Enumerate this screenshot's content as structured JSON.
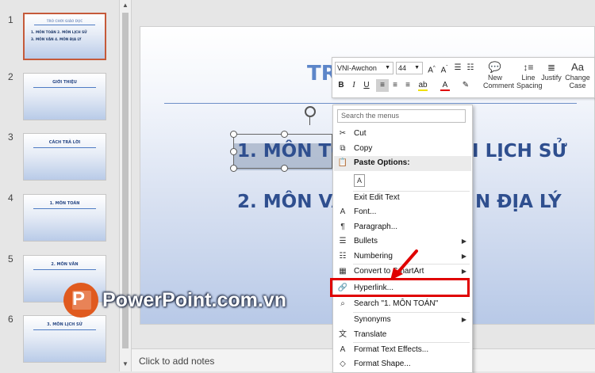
{
  "thumbnails": [
    {
      "num": "1",
      "title": "TRÒ CHƠI GIÁO DỤC",
      "lines": [
        "1. MÔN TOÁN   2. MÔN LỊCH SỬ",
        "3. MÔN VĂN    4. MÔN ĐỊA LÝ"
      ],
      "selected": true
    },
    {
      "num": "2",
      "title": "GIỚI THIỆU",
      "lines": [],
      "selected": false
    },
    {
      "num": "3",
      "title": "CÁCH TRẢ LỜI",
      "lines": [],
      "selected": false
    },
    {
      "num": "4",
      "title": "1. MÔN TOÁN",
      "lines": [],
      "selected": false
    },
    {
      "num": "5",
      "title": "2. MÔN VĂN",
      "lines": [],
      "selected": false
    },
    {
      "num": "6",
      "title": "3. MÔN LỊCH SỬ",
      "lines": [],
      "selected": false
    }
  ],
  "slide": {
    "title_fragment": "TR",
    "line1_left": "1. MÔN TO",
    "line1_right": "I LỊCH SỬ",
    "line2_left": "2. MÔN VA",
    "line2_right": "N ĐỊA LÝ"
  },
  "notes": {
    "placeholder": "Click to add notes"
  },
  "mini_toolbar": {
    "font_name": "VNI-Awchon",
    "font_size": "44",
    "new_comment": [
      "New",
      "Comment"
    ],
    "line_spacing": [
      "Line",
      "Spacing"
    ],
    "justify": "Justify",
    "change_case": [
      "Change",
      "Case"
    ],
    "change_case_glyph": "Aa"
  },
  "context_menu": {
    "search_placeholder": "Search the menus",
    "items": [
      {
        "label": "Cut",
        "icon": "scissors-icon",
        "glyph": "✂"
      },
      {
        "label": "Copy",
        "icon": "copy-icon",
        "glyph": "⧉"
      },
      {
        "label": "Paste Options:",
        "icon": "clipboard-icon",
        "glyph": "📋",
        "header": true
      },
      {
        "label": "",
        "icon": "paste-keep-text-icon",
        "glyph": "A"
      },
      {
        "label": "Exit Edit Text",
        "icon": "",
        "glyph": ""
      },
      {
        "label": "Font...",
        "icon": "font-icon",
        "glyph": "A"
      },
      {
        "label": "Paragraph...",
        "icon": "paragraph-icon",
        "glyph": "¶"
      },
      {
        "label": "Bullets",
        "icon": "bullets-icon",
        "glyph": "☰",
        "submenu": true
      },
      {
        "label": "Numbering",
        "icon": "numbering-icon",
        "glyph": "☷",
        "submenu": true
      },
      {
        "label": "Convert to SmartArt",
        "icon": "smartart-icon",
        "glyph": "▦",
        "submenu": true
      },
      {
        "label": "Hyperlink...",
        "icon": "hyperlink-icon",
        "glyph": "🔗"
      },
      {
        "label": "Search \"1. MÔN TOÁN\"",
        "icon": "search-icon",
        "glyph": "⌕"
      },
      {
        "label": "Synonyms",
        "icon": "",
        "glyph": "",
        "submenu": true
      },
      {
        "label": "Translate",
        "icon": "translate-icon",
        "glyph": "文"
      },
      {
        "label": "Format Text Effects...",
        "icon": "text-effects-icon",
        "glyph": "A"
      },
      {
        "label": "Format Shape...",
        "icon": "format-shape-icon",
        "glyph": "◇"
      }
    ]
  },
  "watermark": {
    "text": "PowerPoint.com.vn",
    "letter": "P"
  },
  "colors": {
    "accent_red": "#e00000",
    "slide_text": "#2f4f8f",
    "logo_orange": "#e05a1f"
  }
}
